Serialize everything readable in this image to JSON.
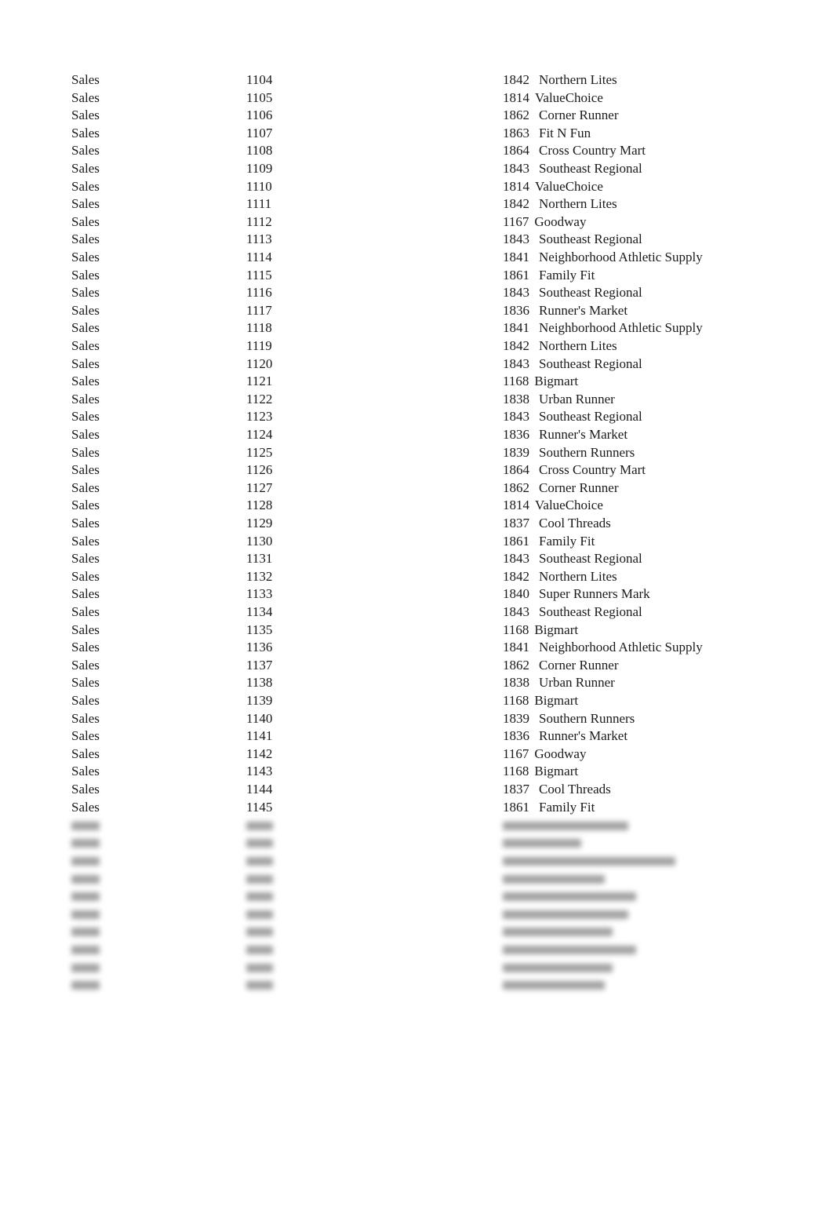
{
  "rows": [
    {
      "dept": "Sales",
      "id": "1104",
      "cust_id": "1842",
      "cust_name": "Northern Lites"
    },
    {
      "dept": "Sales",
      "id": "1105",
      "cust_id": "1814",
      "cust_name": "ValueChoice"
    },
    {
      "dept": "Sales",
      "id": "1106",
      "cust_id": "1862",
      "cust_name": "Corner Runner"
    },
    {
      "dept": "Sales",
      "id": "1107",
      "cust_id": "1863",
      "cust_name": "Fit N Fun"
    },
    {
      "dept": "Sales",
      "id": "1108",
      "cust_id": "1864",
      "cust_name": "Cross Country Mart"
    },
    {
      "dept": "Sales",
      "id": "1109",
      "cust_id": "1843",
      "cust_name": "Southeast Regional"
    },
    {
      "dept": "Sales",
      "id": "1110",
      "cust_id": "1814",
      "cust_name": "ValueChoice"
    },
    {
      "dept": "Sales",
      "id": "1111",
      "cust_id": "1842",
      "cust_name": "Northern Lites"
    },
    {
      "dept": "Sales",
      "id": "1112",
      "cust_id": "1167",
      "cust_name": "Goodway"
    },
    {
      "dept": "Sales",
      "id": "1113",
      "cust_id": "1843",
      "cust_name": "Southeast Regional"
    },
    {
      "dept": "Sales",
      "id": "1114",
      "cust_id": "1841",
      "cust_name": "Neighborhood Athletic Supply"
    },
    {
      "dept": "Sales",
      "id": "1115",
      "cust_id": "1861",
      "cust_name": "Family Fit"
    },
    {
      "dept": "Sales",
      "id": "1116",
      "cust_id": "1843",
      "cust_name": "Southeast Regional"
    },
    {
      "dept": "Sales",
      "id": "1117",
      "cust_id": "1836",
      "cust_name": "Runner's Market"
    },
    {
      "dept": "Sales",
      "id": "1118",
      "cust_id": "1841",
      "cust_name": "Neighborhood Athletic Supply"
    },
    {
      "dept": "Sales",
      "id": "1119",
      "cust_id": "1842",
      "cust_name": "Northern Lites"
    },
    {
      "dept": "Sales",
      "id": "1120",
      "cust_id": "1843",
      "cust_name": "Southeast Regional"
    },
    {
      "dept": "Sales",
      "id": "1121",
      "cust_id": "1168",
      "cust_name": "Bigmart"
    },
    {
      "dept": "Sales",
      "id": "1122",
      "cust_id": "1838",
      "cust_name": "Urban Runner"
    },
    {
      "dept": "Sales",
      "id": "1123",
      "cust_id": "1843",
      "cust_name": "Southeast Regional"
    },
    {
      "dept": "Sales",
      "id": "1124",
      "cust_id": "1836",
      "cust_name": "Runner's Market"
    },
    {
      "dept": "Sales",
      "id": "1125",
      "cust_id": "1839",
      "cust_name": "Southern Runners"
    },
    {
      "dept": "Sales",
      "id": "1126",
      "cust_id": "1864",
      "cust_name": "Cross Country Mart"
    },
    {
      "dept": "Sales",
      "id": "1127",
      "cust_id": "1862",
      "cust_name": "Corner Runner"
    },
    {
      "dept": "Sales",
      "id": "1128",
      "cust_id": "1814",
      "cust_name": "ValueChoice"
    },
    {
      "dept": "Sales",
      "id": "1129",
      "cust_id": "1837",
      "cust_name": "Cool Threads"
    },
    {
      "dept": "Sales",
      "id": "1130",
      "cust_id": "1861",
      "cust_name": "Family Fit"
    },
    {
      "dept": "Sales",
      "id": "1131",
      "cust_id": "1843",
      "cust_name": "Southeast Regional"
    },
    {
      "dept": "Sales",
      "id": "1132",
      "cust_id": "1842",
      "cust_name": "Northern Lites"
    },
    {
      "dept": "Sales",
      "id": "1133",
      "cust_id": "1840",
      "cust_name": "Super Runners Mark"
    },
    {
      "dept": "Sales",
      "id": "1134",
      "cust_id": "1843",
      "cust_name": "Southeast Regional"
    },
    {
      "dept": "Sales",
      "id": "1135",
      "cust_id": "1168",
      "cust_name": "Bigmart"
    },
    {
      "dept": "Sales",
      "id": "1136",
      "cust_id": "1841",
      "cust_name": "Neighborhood Athletic Supply"
    },
    {
      "dept": "Sales",
      "id": "1137",
      "cust_id": "1862",
      "cust_name": "Corner Runner"
    },
    {
      "dept": "Sales",
      "id": "1138",
      "cust_id": "1838",
      "cust_name": "Urban Runner"
    },
    {
      "dept": "Sales",
      "id": "1139",
      "cust_id": "1168",
      "cust_name": "Bigmart"
    },
    {
      "dept": "Sales",
      "id": "1140",
      "cust_id": "1839",
      "cust_name": "Southern Runners"
    },
    {
      "dept": "Sales",
      "id": "1141",
      "cust_id": "1836",
      "cust_name": "Runner's Market"
    },
    {
      "dept": "Sales",
      "id": "1142",
      "cust_id": "1167",
      "cust_name": "Goodway"
    },
    {
      "dept": "Sales",
      "id": "1143",
      "cust_id": "1168",
      "cust_name": "Bigmart"
    },
    {
      "dept": "Sales",
      "id": "1144",
      "cust_id": "1837",
      "cust_name": "Cool Threads"
    },
    {
      "dept": "Sales",
      "id": "1145",
      "cust_id": "1861",
      "cust_name": "Family Fit"
    }
  ],
  "blurred_row_count": 10
}
